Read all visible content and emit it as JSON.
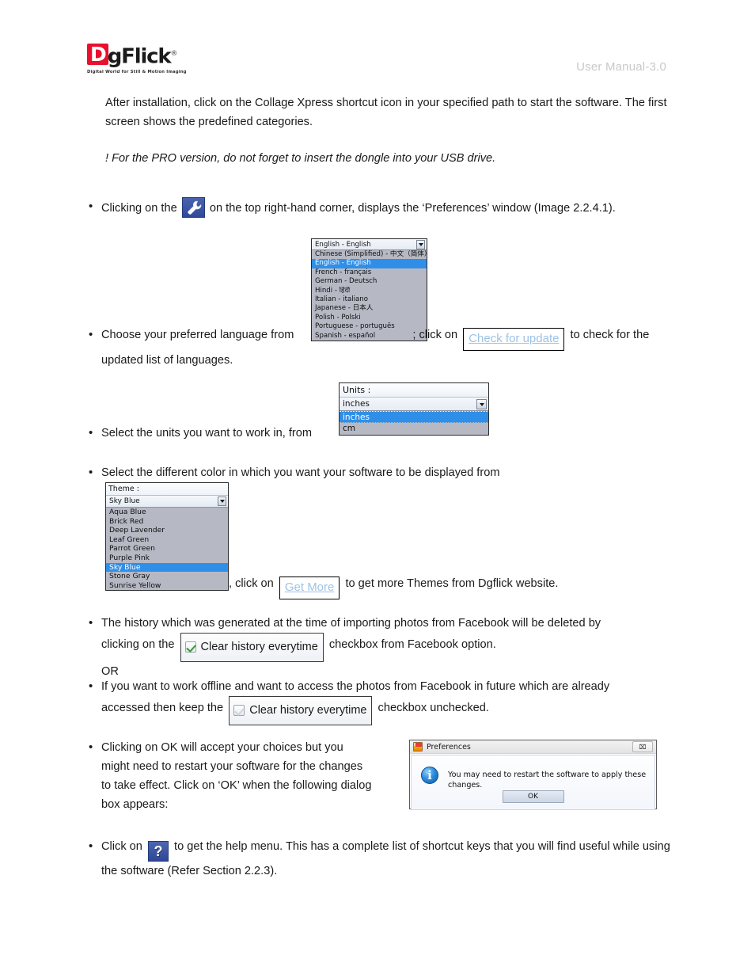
{
  "header": {
    "logo_d": "D",
    "logo_rest": "gFlick",
    "logo_reg": "®",
    "logo_tagline": "Digital World for Still & Motion Imaging",
    "manual_label": "User Manual-3.0"
  },
  "intro": {
    "line1": "After installation, click on the Collage Xpress shortcut icon in your specified path to start the software. The first screen shows the predefined categories.",
    "note": "! For the PRO version, do not forget to insert the dongle into your USB drive."
  },
  "bullets": {
    "preferences": {
      "dot": "•",
      "before_icon": "Clicking on the",
      "after_icon": "on the top right-hand corner, displays the ‘Preferences’ window (Image 2.2.4.1)."
    },
    "language": {
      "dot": "•",
      "before_widget": "Choose your preferred language from",
      "mid": "; click on",
      "after_button": "to check for the updated list of languages."
    },
    "units": {
      "dot": "•",
      "text": "Select the units you want to work in, from"
    },
    "theme": {
      "dot": "•",
      "text": "Select the different color in which you want your software to be displayed from",
      "after_widget": ", click on",
      "after_button": "to get more Themes from Dgflick website."
    },
    "history_checked": {
      "dot": "•",
      "line_a": "The history which was generated at the time of importing photos from Facebook will be deleted by",
      "line_b_before": "clicking on the",
      "line_b_after": "checkbox from Facebook option.",
      "or": "OR"
    },
    "history_unchecked": {
      "dot": "•",
      "line_a": "If you want to work offline and want to access the photos from Facebook in future which are already",
      "line_b_before": "accessed then keep the",
      "line_b_after": "checkbox unchecked."
    },
    "ok_dialog": {
      "dot": "•",
      "text": "Clicking on OK will accept your choices but you might need to restart your software for the changes to take effect. Click on ‘OK’ when the following dialog box appears:"
    },
    "help": {
      "dot": "•",
      "before_icon": "Click on",
      "after_icon": "to get the help menu. This has a complete list of shortcut keys that you will find useful while using the software (Refer Section 2.2.3)."
    }
  },
  "icons": {
    "wrench": "wrench-icon",
    "help": "?"
  },
  "buttons": {
    "check_for_update": "Check for update",
    "get_more": "Get More"
  },
  "checkbox_chips": {
    "checked_label": "Clear history everytime",
    "unchecked_label": "Clear history everytime"
  },
  "language_combo": {
    "selected": "English - English",
    "options": [
      "Chinese (Simplified) - 中文（简体）",
      "English - English",
      "French - français",
      "German - Deutsch",
      "Hindi - हिंदी",
      "Italian - italiano",
      "Japanese - 日本人",
      "Polish - Polski",
      "Portuguese - português",
      "Spanish - español"
    ],
    "selected_index": 1
  },
  "units_combo": {
    "header": "Units :",
    "selected": "inches",
    "options": [
      "inches",
      "cm"
    ],
    "selected_index": 0
  },
  "theme_combo": {
    "header": "Theme :",
    "selected": "Sky Blue",
    "options": [
      "Aqua Blue",
      "Brick Red",
      "Deep Lavender",
      "Leaf Green",
      "Parrot Green",
      "Purple Pink",
      "Sky Blue",
      "Stone Gray",
      "Sunrise Yellow"
    ],
    "selected_index": 6
  },
  "dialog": {
    "title": "Preferences",
    "close_glyph": "⌧",
    "info_glyph": "i",
    "message": "You may need to restart the software to apply these changes.",
    "ok_label": "OK"
  },
  "colors": {
    "brand_red": "#e8112d",
    "highlight_blue": "#2f8fe8",
    "link_blue": "#9dc3e6",
    "icon_blue": "#3a54a1",
    "combo_bg": "#b6b9c4"
  }
}
